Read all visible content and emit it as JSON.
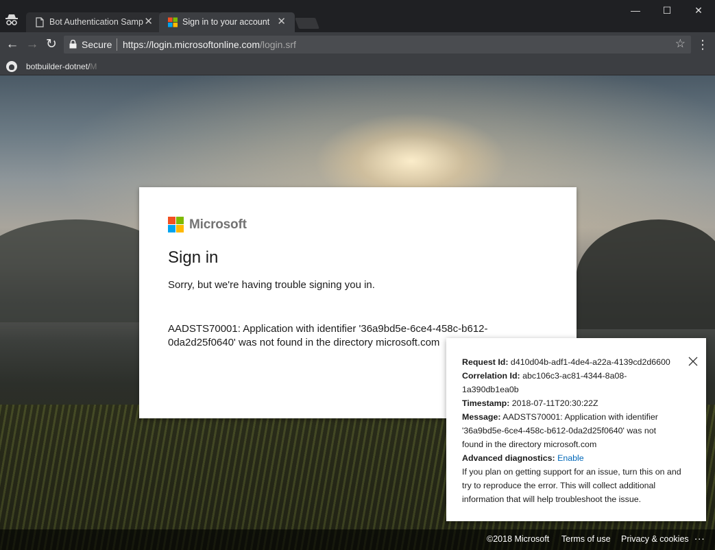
{
  "browser": {
    "tabs": [
      {
        "title": "Bot Authentication Samp",
        "favicon": "document-icon",
        "active": false
      },
      {
        "title": "Sign in to your account",
        "favicon": "microsoft-logo-icon",
        "active": true
      }
    ],
    "address": {
      "secure_label": "Secure",
      "url_host": "https://login.microsoftonline.com",
      "url_path": "/login.srf"
    },
    "bookmarks": [
      {
        "label": "botbuilder-dotnet/",
        "label_fade": "M",
        "icon": "github-icon"
      }
    ]
  },
  "card": {
    "brand": "Microsoft",
    "title": "Sign in",
    "subtitle": "Sorry, but we're having trouble signing you in.",
    "error": "AADSTS70001: Application with identifier '36a9bd5e-6ce4-458c-b612-0da2d25f0640' was not found in the directory microsoft.com"
  },
  "debug": {
    "request_id_label": "Request Id:",
    "request_id": "d410d04b-adf1-4de4-a22a-4139cd2d6600",
    "correlation_id_label": "Correlation Id:",
    "correlation_id": "abc106c3-ac81-4344-8a08-1a390db1ea0b",
    "timestamp_label": "Timestamp:",
    "timestamp": "2018-07-11T20:30:22Z",
    "message_label": "Message:",
    "message": "AADSTS70001: Application with identifier '36a9bd5e-6ce4-458c-b612-0da2d25f0640' was not found in the directory microsoft.com",
    "advanced_label": "Advanced diagnostics:",
    "advanced_link": "Enable",
    "advanced_help": "If you plan on getting support for an issue, turn this on and try to reproduce the error. This will collect additional information that will help troubleshoot the issue."
  },
  "footer": {
    "copyright": "©2018 Microsoft",
    "terms": "Terms of use",
    "privacy": "Privacy & cookies",
    "more": "..."
  },
  "colors": {
    "ms_red": "#f25022",
    "ms_green": "#7fba00",
    "ms_blue": "#00a4ef",
    "ms_yellow": "#ffb900",
    "link": "#0067b8"
  }
}
